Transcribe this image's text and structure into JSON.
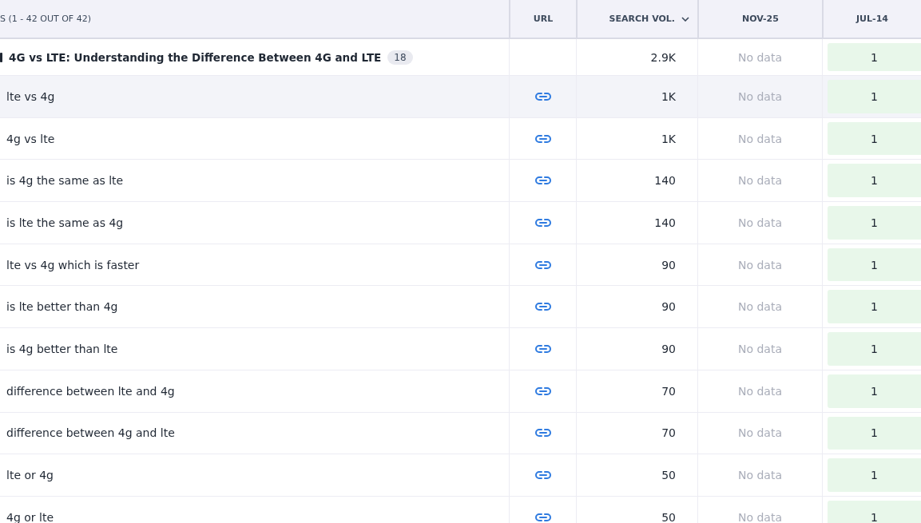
{
  "columns": [
    {
      "label": "S (1 - 42 OUT OF 42)",
      "kind": "text"
    },
    {
      "label": "URL",
      "kind": "url"
    },
    {
      "label": "SEARCH VOL.",
      "kind": "sorted"
    },
    {
      "label": "NOV-25",
      "kind": "text"
    },
    {
      "label": "JUL-14",
      "kind": "text"
    }
  ],
  "rows": [
    {
      "kind": "group",
      "keyword": "4G vs LTE: Understanding the Difference Between 4G and LTE",
      "count": "18",
      "volume": "2.9K",
      "nov": "No data",
      "jul": "1",
      "highlighted": false
    },
    {
      "kind": "keyword",
      "keyword": "lte vs 4g",
      "volume": "1K",
      "nov": "No data",
      "jul": "1",
      "highlighted": true
    },
    {
      "kind": "keyword",
      "keyword": "4g vs lte",
      "volume": "1K",
      "nov": "No data",
      "jul": "1",
      "highlighted": false
    },
    {
      "kind": "keyword",
      "keyword": "is 4g the same as lte",
      "volume": "140",
      "nov": "No data",
      "jul": "1",
      "highlighted": false
    },
    {
      "kind": "keyword",
      "keyword": "is lte the same as 4g",
      "volume": "140",
      "nov": "No data",
      "jul": "1",
      "highlighted": false
    },
    {
      "kind": "keyword",
      "keyword": "lte vs 4g which is faster",
      "volume": "90",
      "nov": "No data",
      "jul": "1",
      "highlighted": false
    },
    {
      "kind": "keyword",
      "keyword": "is lte better than 4g",
      "volume": "90",
      "nov": "No data",
      "jul": "1",
      "highlighted": false
    },
    {
      "kind": "keyword",
      "keyword": "is 4g better than lte",
      "volume": "90",
      "nov": "No data",
      "jul": "1",
      "highlighted": false
    },
    {
      "kind": "keyword",
      "keyword": "difference between lte and 4g",
      "volume": "70",
      "nov": "No data",
      "jul": "1",
      "highlighted": false
    },
    {
      "kind": "keyword",
      "keyword": "difference between 4g and lte",
      "volume": "70",
      "nov": "No data",
      "jul": "1",
      "highlighted": false
    },
    {
      "kind": "keyword",
      "keyword": "lte or 4g",
      "volume": "50",
      "nov": "No data",
      "jul": "1",
      "highlighted": false
    },
    {
      "kind": "keyword",
      "keyword": "4g or lte",
      "volume": "50",
      "nov": "No data",
      "jul": "1",
      "highlighted": false
    }
  ]
}
